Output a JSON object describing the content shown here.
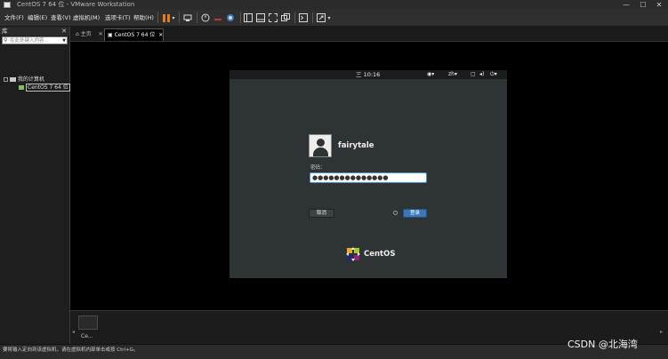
{
  "window": {
    "title": "CentOS 7 64 位 - VMware Workstation",
    "controls": [
      "—",
      "☐",
      "✕"
    ]
  },
  "menubar": {
    "items": [
      "文件(F)",
      "编辑(E)",
      "查看(V)",
      "虚拟机(M)",
      "选项卡(T)",
      "帮助(H)"
    ]
  },
  "toolbar": {
    "icons": [
      "pause-icon",
      "send-keys-icon",
      "snapshot-icon",
      "revert-snapshot-icon",
      "snapshot-manager-icon",
      "library-view-icon",
      "thumbnail-view-icon",
      "fullscreen-icon",
      "unity-icon",
      "console-view-icon",
      "stretch-guest-icon"
    ],
    "pause_color": "#e87a1e"
  },
  "library": {
    "title": "库",
    "close": "✕",
    "search_placeholder": "在此处键入内容...",
    "tree": {
      "root_label": "我的计算机",
      "vm_label": "CentOS 7 64 位"
    }
  },
  "tabs": {
    "home_label": "主页",
    "vm_label": "CentOS 7 64 位"
  },
  "guest": {
    "topbar": {
      "clock": "三 10:16",
      "keyboard_layout": "zh",
      "icons": [
        "accessibility-icon",
        "screen-icon",
        "volume-icon",
        "power-icon"
      ]
    },
    "login": {
      "username": "fairytale",
      "password_label": "密码：",
      "password_value": "●●●●●●●●●●●●●●",
      "cancel_label": "取消",
      "login_label": "登录"
    },
    "logo_text": "CentOS"
  },
  "thumbnails": {
    "items": [
      {
        "label": "Ce..."
      }
    ]
  },
  "statusbar": {
    "text": "要将输入定向到该虚拟机，请在虚拟机内部单击或按 Ctrl+G。"
  },
  "watermark": "CSDN @北海湾"
}
